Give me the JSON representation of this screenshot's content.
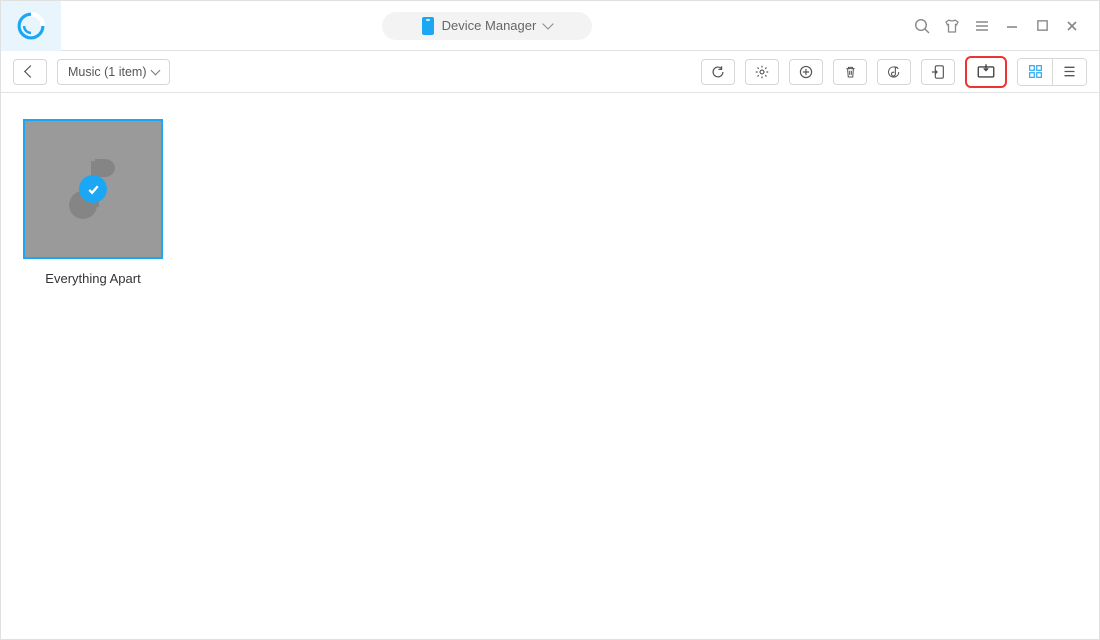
{
  "titlebar": {
    "title": "Device Manager"
  },
  "toolbar": {
    "category": "Music (1 item)"
  },
  "content": {
    "items": [
      {
        "label": "Everything Apart",
        "selected": true
      }
    ]
  },
  "colors": {
    "accent": "#1ba7f4",
    "highlight": "#e33"
  }
}
